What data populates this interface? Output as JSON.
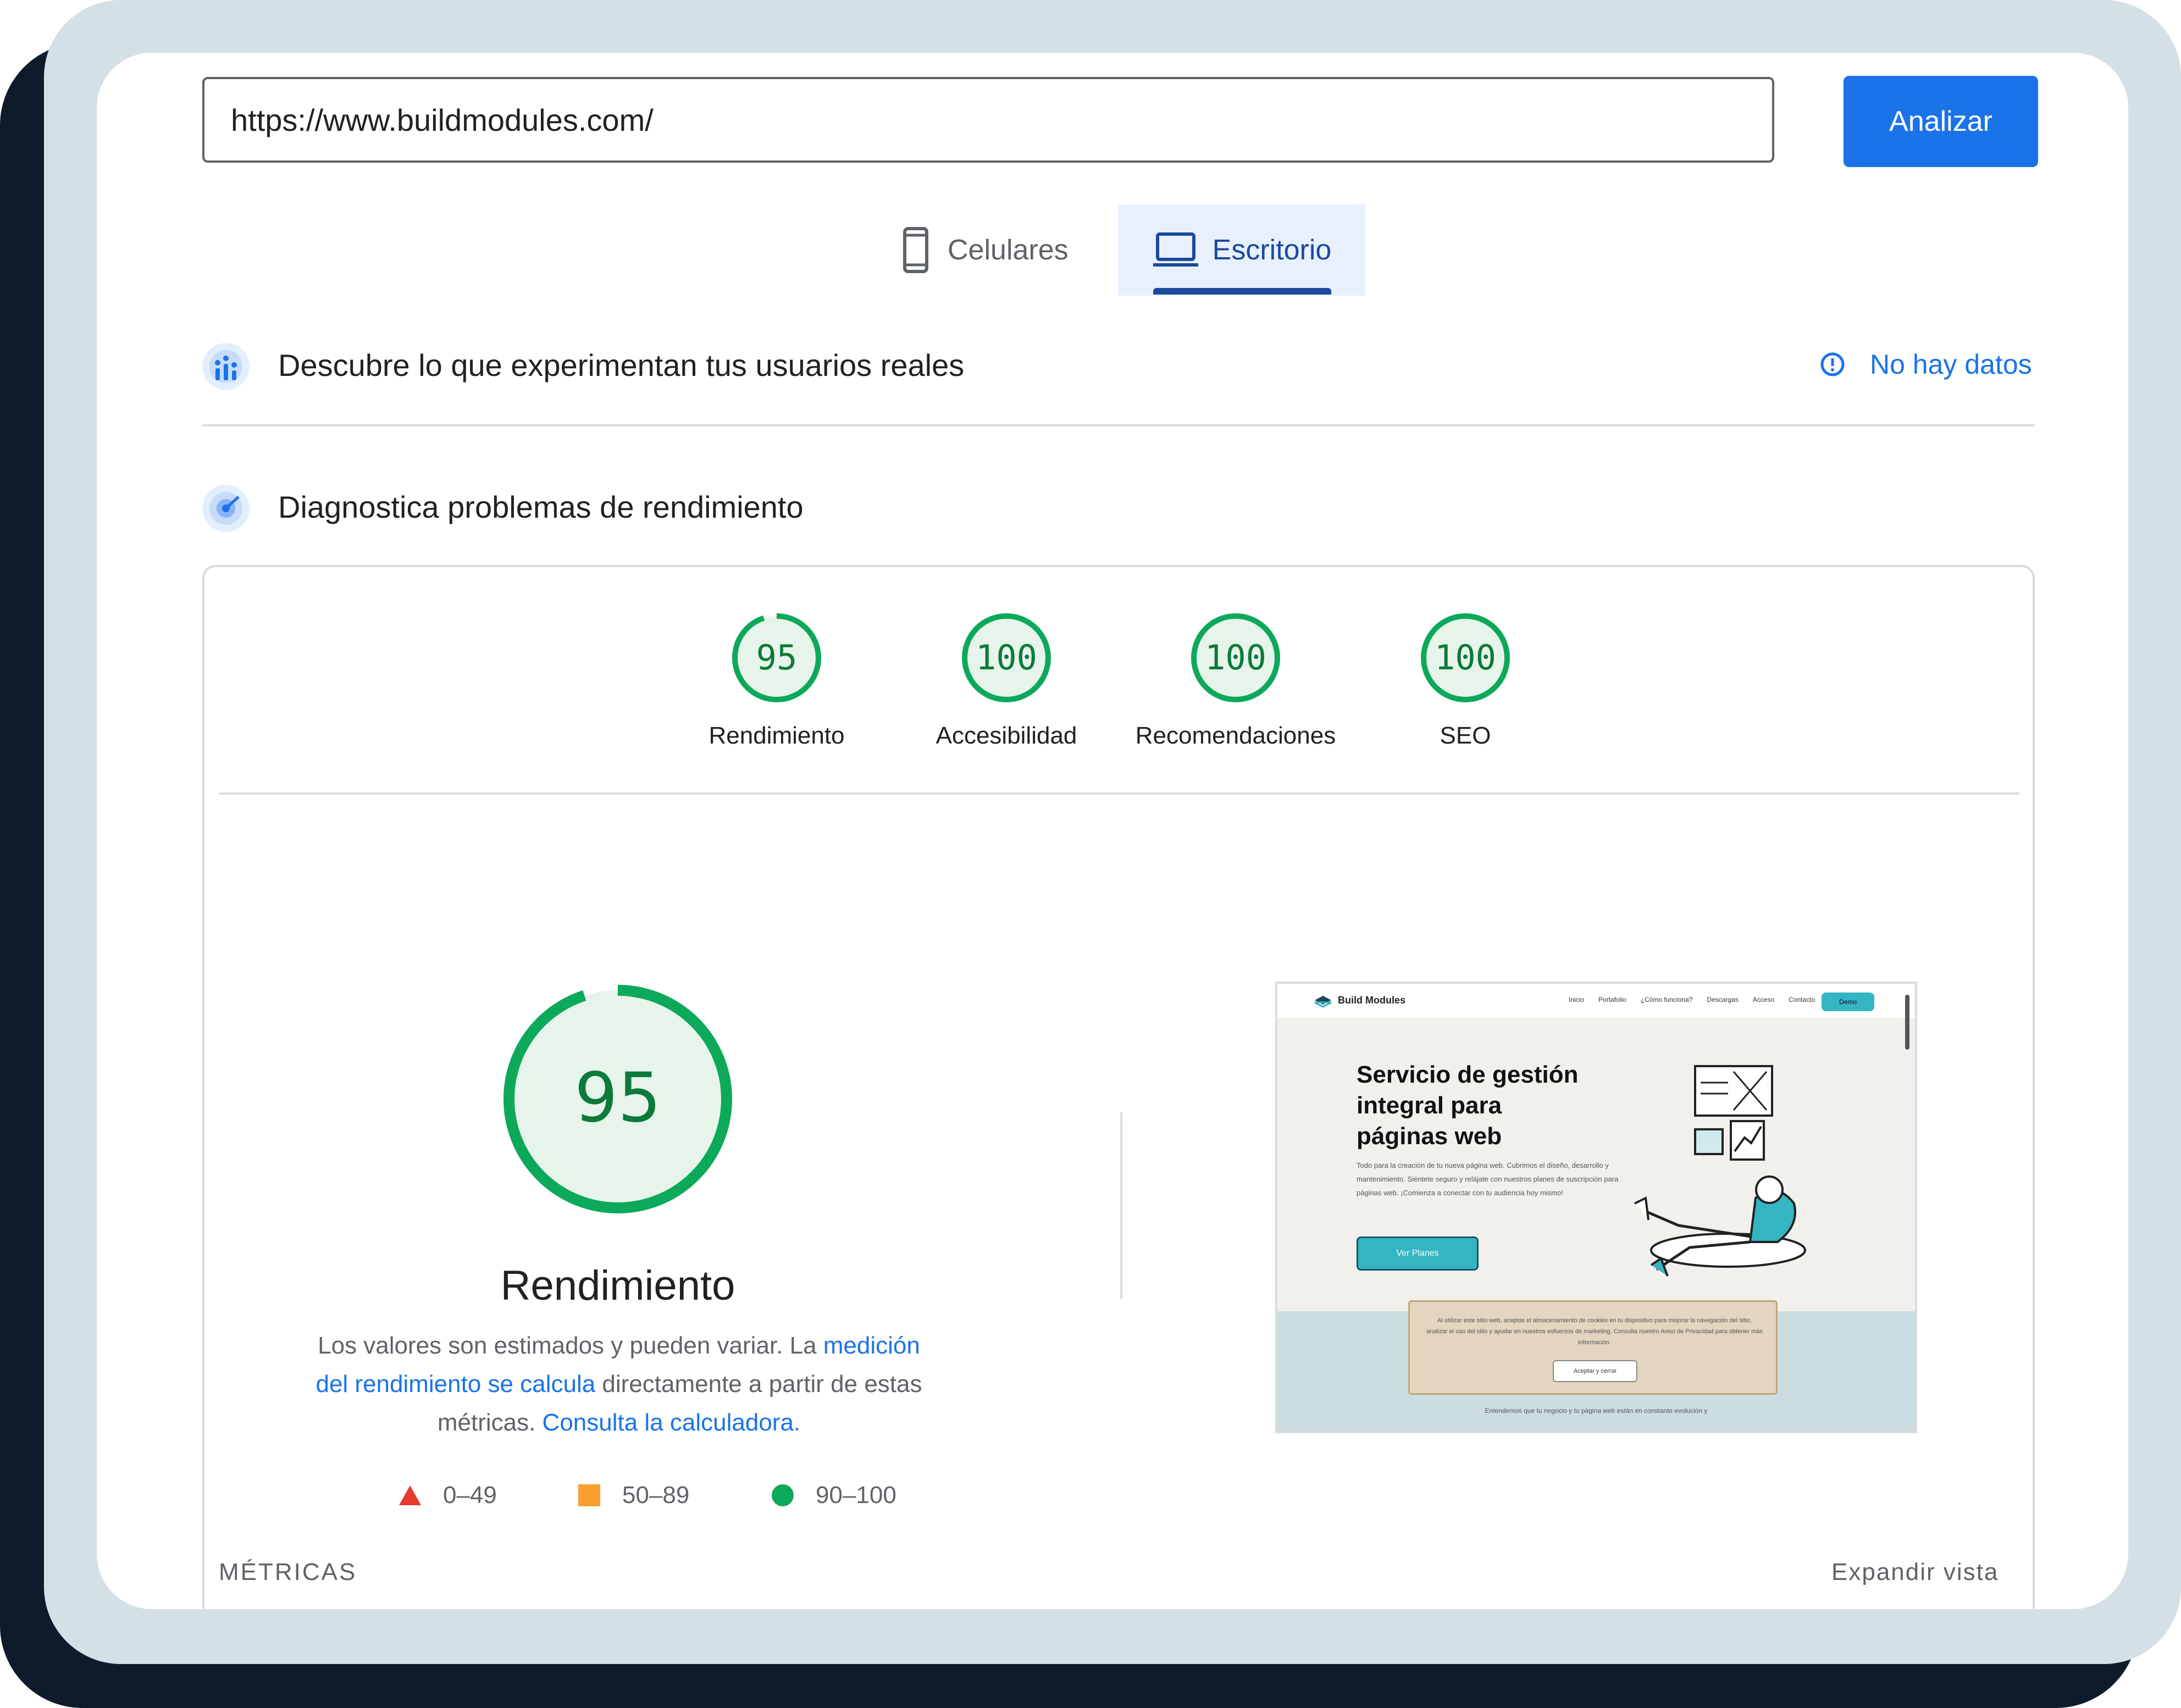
{
  "url_input": {
    "value": "https://www.buildmodules.com/"
  },
  "analyze_button": "Analizar",
  "tabs": [
    {
      "label": "Celulares",
      "icon": "smartphone-icon",
      "selected": false
    },
    {
      "label": "Escritorio",
      "icon": "laptop-icon",
      "selected": true
    }
  ],
  "field_data": {
    "title": "Descubre lo que experimentan tus usuarios reales",
    "icon": "users-chart-icon",
    "status_icon": "info-icon",
    "status": "No hay datos"
  },
  "lab_data": {
    "title": "Diagnostica problemas de rendimiento",
    "icon": "gauge-target-icon"
  },
  "categories": [
    {
      "score": "95",
      "label": "Rendimiento",
      "fraction": 0.95
    },
    {
      "score": "100",
      "label": "Accesibilidad",
      "fraction": 1.0
    },
    {
      "score": "100",
      "label": "Recomendaciones",
      "fraction": 1.0
    },
    {
      "score": "100",
      "label": "SEO",
      "fraction": 1.0
    }
  ],
  "performance": {
    "score": "95",
    "fraction": 0.95,
    "title": "Rendimiento",
    "desc_part1": "Los valores son estimados y pueden variar. La ",
    "desc_link1": "medición del rendimiento se calcula",
    "desc_part2": " directamente a partir de estas métricas. ",
    "desc_link2": "Consulta la calculadora."
  },
  "legend": [
    {
      "range": "0–49",
      "shape": "triangle",
      "color": "#e8382f"
    },
    {
      "range": "50–89",
      "shape": "square",
      "color": "#fa9f2f"
    },
    {
      "range": "90–100",
      "shape": "circle",
      "color": "#0ca95a"
    }
  ],
  "metrics_label": "MÉTRICAS",
  "expand_view": "Expandir vista",
  "screenshot": {
    "logo": "Build Modules",
    "nav": [
      "Inicio",
      "Portafolio",
      "¿Cómo funciona?",
      "Descargas",
      "Acceso",
      "Contacto"
    ],
    "nav_button": "Demo",
    "heading": "Servicio de gestión integral para páginas web",
    "paragraph": "Todo para la creación de tu nueva página web. Cubrimos el diseño, desarrollo y mantenimiento. Siéntete seguro y relájate con nuestros planes de suscripción para páginas web. ¡Comienza a conectar con tu audiencia hoy mismo!",
    "cta": "Ver Planes",
    "cookie_text": "Al utilizar este sitio web, aceptas el almacenamiento de cookies en tu dispositivo para mejorar la navegación del sitio, analizar el uso del sitio y ayudar en nuestros esfuerzos de marketing. Consulta nuestro Aviso de Privacidad para obtener más información.",
    "cookie_button": "Aceptar y cerrar",
    "footer_text": "Entendemos que tu negocio y tu página web están en constante evolución y"
  },
  "colors": {
    "pass": "#0ca95a",
    "pass_bg": "#e6f4ea",
    "pass_text": "#0c7a3a",
    "accent": "#1a73e8",
    "tab_selected": "#1a4a9c"
  }
}
